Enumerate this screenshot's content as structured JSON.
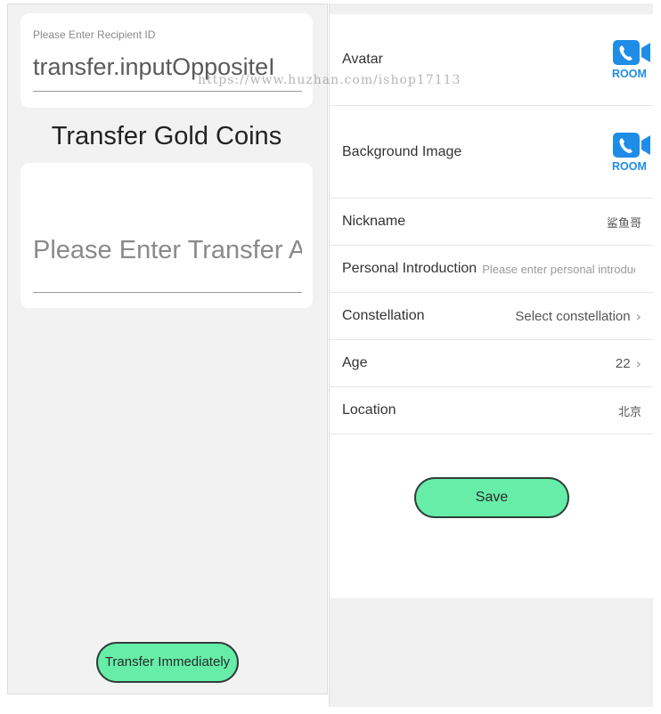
{
  "transfer": {
    "recipient_label": "Please Enter Recipient ID",
    "recipient_value": "transfer.inputOppositeI",
    "title": "Transfer Gold Coins",
    "amount_placeholder": "Please Enter Transfer Amount",
    "submit_label": "Transfer Immediately"
  },
  "profile": {
    "avatar_label": "Avatar",
    "background_label": "Background Image",
    "room_icon_text": "ROOM",
    "nickname_label": "Nickname",
    "nickname_value": "鲨鱼哥",
    "intro_label": "Personal Introduction",
    "intro_placeholder": "Please enter personal introduction",
    "constellation_label": "Constellation",
    "constellation_value": "Select constellation",
    "age_label": "Age",
    "age_value": "22",
    "location_label": "Location",
    "location_value": "北京",
    "save_label": "Save"
  },
  "watermark": "https://www.huzhan.com/ishop17113",
  "icons": {
    "room": "video-room-icon",
    "chevron": "chevron-right-icon"
  },
  "colors": {
    "accent": "#66eea8",
    "button_border": "#2f3e3a",
    "room_blue": "#1e8de8"
  }
}
